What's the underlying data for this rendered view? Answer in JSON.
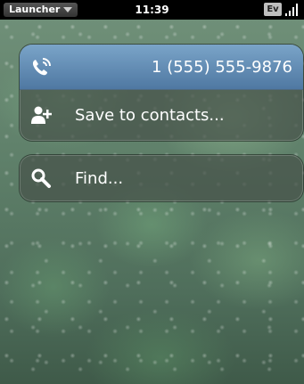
{
  "status_bar": {
    "launcher_label": "Launcher",
    "time": "11:39",
    "network_badge": "Ev"
  },
  "menu": {
    "phone_number": "1 (555) 555-9876",
    "save_to_contacts": "Save to contacts...",
    "find": "Find..."
  },
  "icons": {
    "phone": "phone-icon",
    "add_contact": "add-contact-icon",
    "search": "search-icon",
    "signal": "signal-icon",
    "dropdown": "chevron-down-icon"
  },
  "colors": {
    "phone_row_top": "#7aa4c8",
    "phone_row_bottom": "#4f78a2",
    "status_bar": "#000000"
  }
}
